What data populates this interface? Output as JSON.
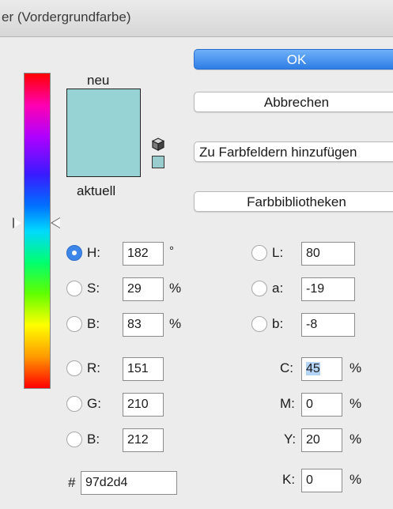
{
  "window": {
    "title": "er (Vordergrundfarbe)"
  },
  "swatches": {
    "new_label": "neu",
    "current_label": "aktuell",
    "new_color": "#97d2d4",
    "current_color": "#97d2d4"
  },
  "buttons": {
    "ok": "OK",
    "cancel": "Abbrechen",
    "add_to_swatches": "Zu Farbfeldern hinzufügen",
    "libraries": "Farbbibliotheken"
  },
  "hsb": [
    {
      "label": "H:",
      "value": "182",
      "unit": "°",
      "selected": true
    },
    {
      "label": "S:",
      "value": "29",
      "unit": "%",
      "selected": false
    },
    {
      "label": "B:",
      "value": "83",
      "unit": "%",
      "selected": false
    }
  ],
  "rgb": [
    {
      "label": "R:",
      "value": "151"
    },
    {
      "label": "G:",
      "value": "210"
    },
    {
      "label": "B:",
      "value": "212"
    }
  ],
  "lab": [
    {
      "label": "L:",
      "value": "80"
    },
    {
      "label": "a:",
      "value": "-19"
    },
    {
      "label": "b:",
      "value": "-8"
    }
  ],
  "cmyk": [
    {
      "label": "C:",
      "value": "45",
      "unit": "%"
    },
    {
      "label": "M:",
      "value": "0",
      "unit": "%"
    },
    {
      "label": "Y:",
      "value": "20",
      "unit": "%"
    },
    {
      "label": "K:",
      "value": "0",
      "unit": "%"
    }
  ],
  "hex": {
    "label": "#",
    "value": "97d2d4"
  },
  "icons": {
    "cube": "cube-icon",
    "web_safe_swatch": "websafe-swatch"
  }
}
